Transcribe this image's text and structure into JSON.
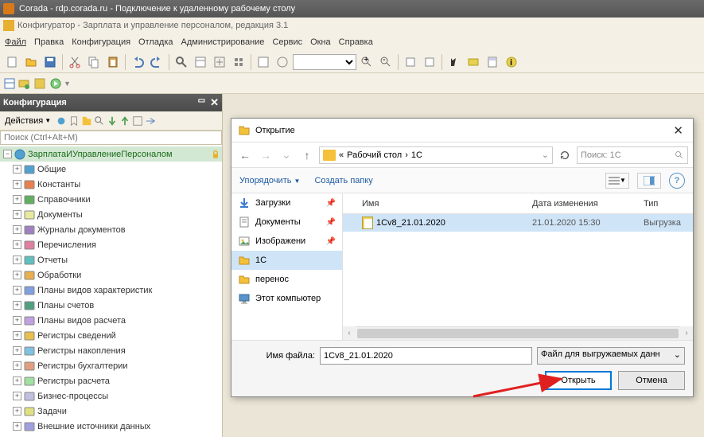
{
  "window_title": "Corada - rdp.corada.ru - Подключение к удаленному рабочему столу",
  "app_title": "Конфигуратор - Зарплата и управление персоналом, редакция 3.1",
  "menu": [
    "Файл",
    "Правка",
    "Конфигурация",
    "Отладка",
    "Администрирование",
    "Сервис",
    "Окна",
    "Справка"
  ],
  "sidebar": {
    "title": "Конфигурация",
    "actions_label": "Действия",
    "search_placeholder": "Поиск (Ctrl+Alt+M)",
    "root": "ЗарплатаИУправлениеПерсоналом",
    "items": [
      "Общие",
      "Константы",
      "Справочники",
      "Документы",
      "Журналы документов",
      "Перечисления",
      "Отчеты",
      "Обработки",
      "Планы видов характеристик",
      "Планы счетов",
      "Планы видов расчета",
      "Регистры сведений",
      "Регистры накопления",
      "Регистры бухгалтерии",
      "Регистры расчета",
      "Бизнес-процессы",
      "Задачи",
      "Внешние источники данных"
    ]
  },
  "dialog": {
    "title": "Открытие",
    "breadcrumb_sep": "«",
    "breadcrumb_parts": [
      "Рабочий стол",
      "1С"
    ],
    "search_placeholder": "Поиск: 1С",
    "organize": "Упорядочить",
    "new_folder": "Создать папку",
    "places": [
      {
        "label": "Загрузки",
        "icon": "download",
        "pinned": true
      },
      {
        "label": "Документы",
        "icon": "doc",
        "pinned": true
      },
      {
        "label": "Изображени",
        "icon": "image",
        "pinned": true
      },
      {
        "label": "1С",
        "icon": "folder",
        "selected": true
      },
      {
        "label": "перенос",
        "icon": "folder"
      },
      {
        "label": "Этот компьютер",
        "icon": "pc"
      }
    ],
    "columns": {
      "name": "Имя",
      "date": "Дата изменения",
      "type": "Тип"
    },
    "files": [
      {
        "name": "1Cv8_21.01.2020",
        "date": "21.01.2020 15:30",
        "type": "Выгрузка",
        "selected": true
      }
    ],
    "filename_label": "Имя файла:",
    "filename_value": "1Cv8_21.01.2020",
    "filter": "Файл для выгружаемых данн",
    "open_btn": "Открыть",
    "cancel_btn": "Отмена"
  }
}
